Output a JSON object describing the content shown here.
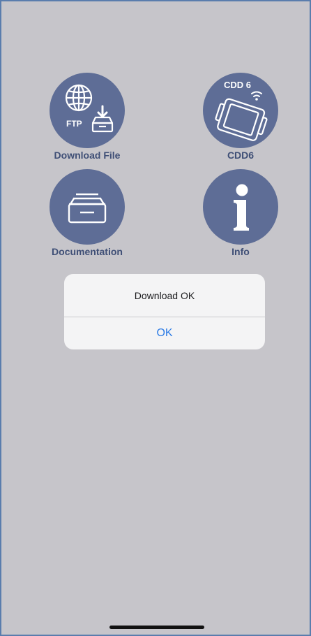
{
  "tiles": {
    "download": {
      "label": "Download File",
      "icon": "ftp-download-icon",
      "badge": "FTP"
    },
    "cdd6": {
      "label": "CDD6",
      "icon": "cdd6-device-icon",
      "badge": "CDD 6"
    },
    "docs": {
      "label": "Documentation",
      "icon": "document-tray-icon"
    },
    "info": {
      "label": "Info",
      "icon": "info-icon"
    }
  },
  "alert": {
    "message": "Download OK",
    "ok_label": "OK"
  },
  "colors": {
    "background": "#c6c5ca",
    "icon_circle": "#5e6d96",
    "label_text": "#3f4f76",
    "alert_bg": "#f4f4f5",
    "ok_blue": "#2c7be5"
  }
}
